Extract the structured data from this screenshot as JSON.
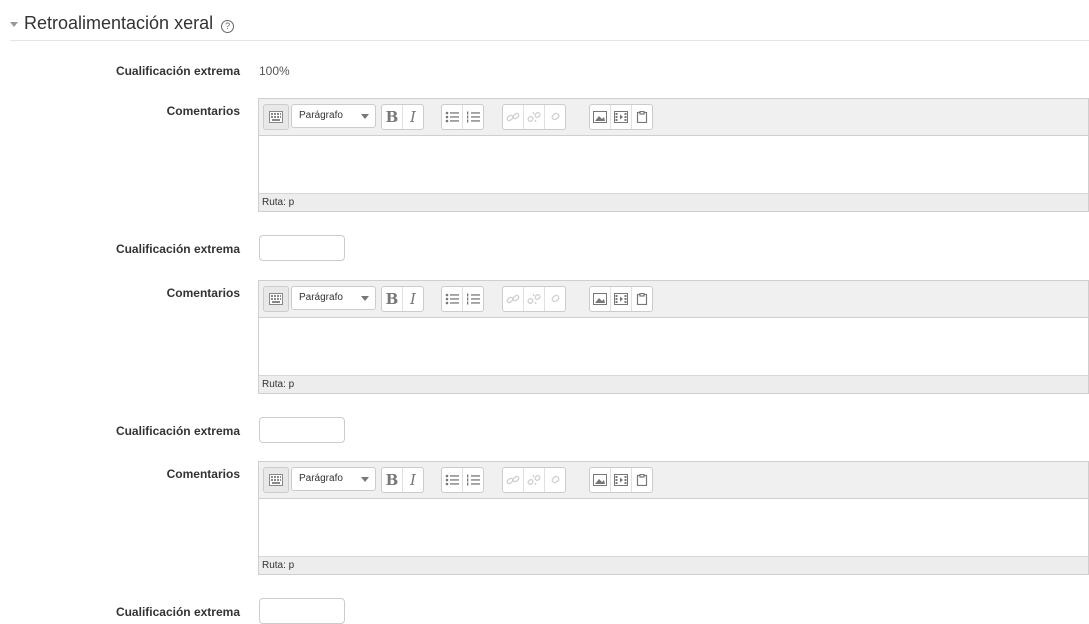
{
  "section": {
    "title": "Retroalimentación xeral",
    "help_symbol": "?"
  },
  "labels": {
    "grade_boundary": "Cualificación extrema",
    "feedback": "Comentarios"
  },
  "first_grade_value": "100%",
  "editor": {
    "paragraph_style": "Parágrafo",
    "bold": "B",
    "italic": "I",
    "path_text": "Ruta: p"
  },
  "grade_inputs": [
    {
      "value": ""
    },
    {
      "value": ""
    },
    {
      "value": ""
    }
  ],
  "colors": {
    "toolbar_bg": "#f0f0f0",
    "border": "#cfcfcf",
    "icon": "#777777"
  }
}
